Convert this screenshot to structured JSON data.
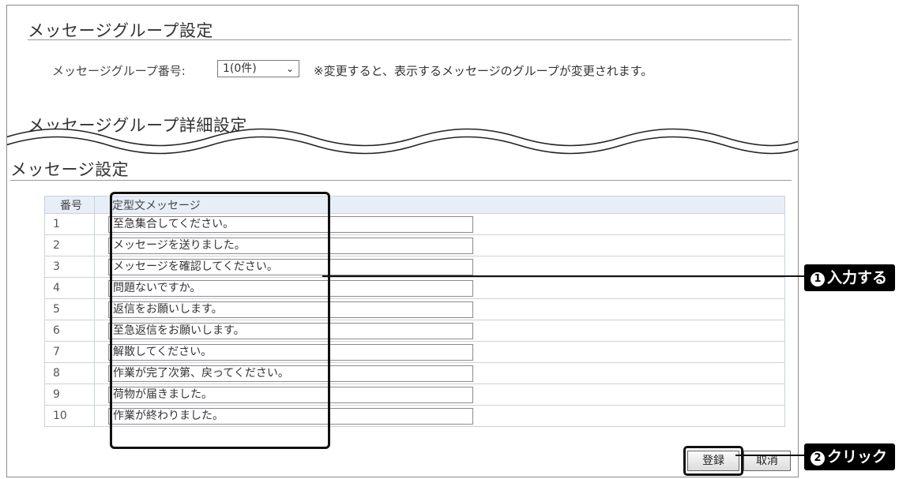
{
  "group_settings": {
    "title": "メッセージグループ設定",
    "label": "メッセージグループ番号:",
    "selected": "1(0件)",
    "note": "※変更すると、表示するメッセージのグループが変更されます。"
  },
  "group_detail": {
    "title": "メッセージグループ詳細設定"
  },
  "message_settings": {
    "title": "メッセージ設定",
    "headers": {
      "num": "番号",
      "message": "定型文メッセージ"
    },
    "rows": [
      {
        "num": "1",
        "message": "至急集合してください。"
      },
      {
        "num": "2",
        "message": "メッセージを送りました。"
      },
      {
        "num": "3",
        "message": "メッセージを確認してください。"
      },
      {
        "num": "4",
        "message": "問題ないですか。"
      },
      {
        "num": "5",
        "message": "返信をお願いします。"
      },
      {
        "num": "6",
        "message": "至急返信をお願いします。"
      },
      {
        "num": "7",
        "message": "解散してください。"
      },
      {
        "num": "8",
        "message": "作業が完了次第、戻ってください。"
      },
      {
        "num": "9",
        "message": "荷物が届きました。"
      },
      {
        "num": "10",
        "message": "作業が終わりました。"
      }
    ]
  },
  "buttons": {
    "register": "登録",
    "cancel": "取消"
  },
  "callouts": {
    "step1_num": "1",
    "step1_text": "入力する",
    "step2_num": "2",
    "step2_text": "クリック"
  }
}
